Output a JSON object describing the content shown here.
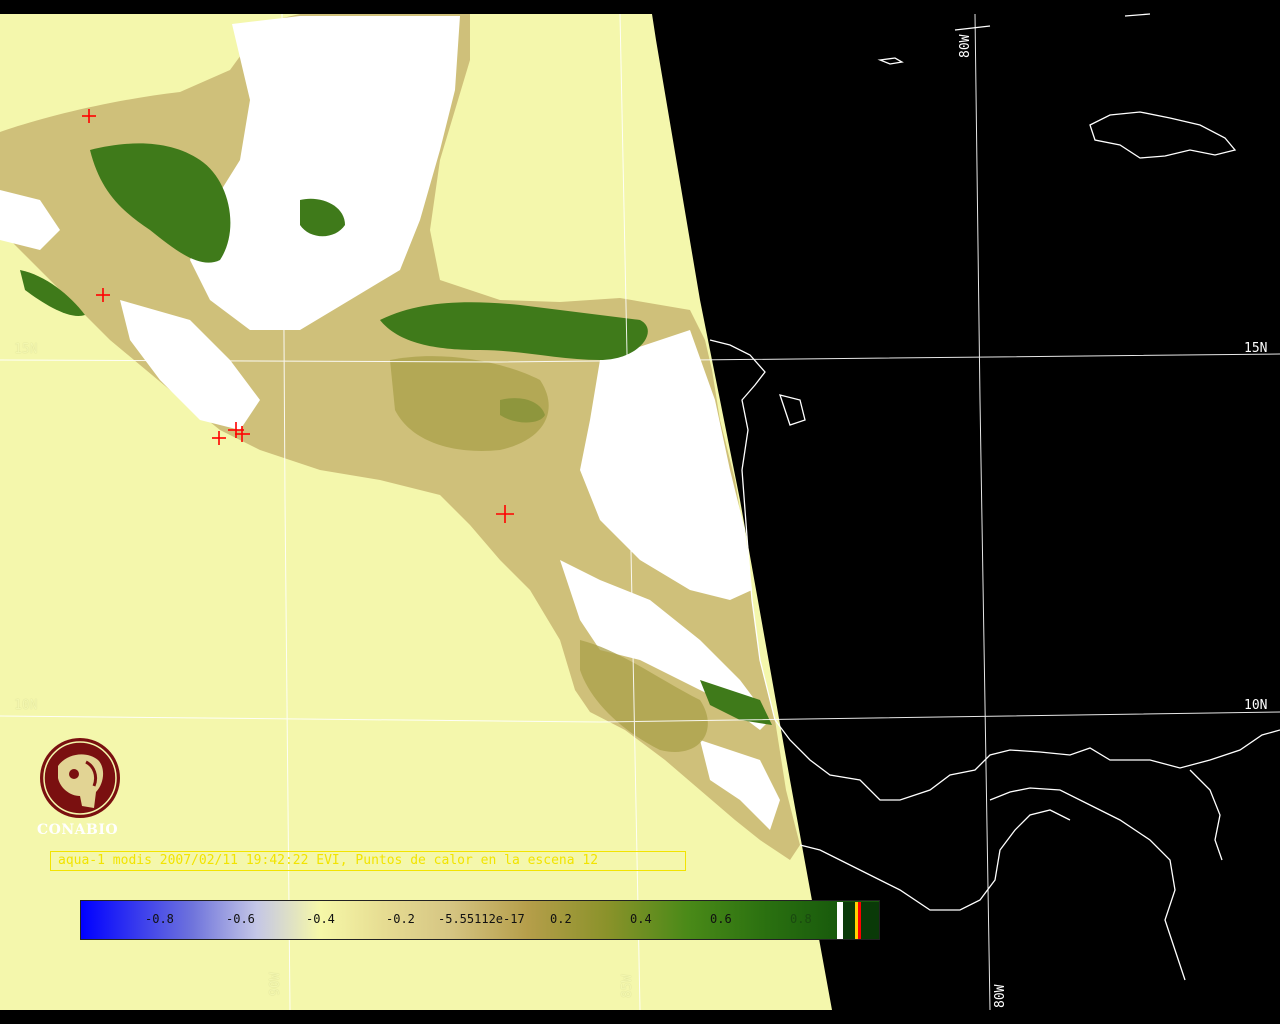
{
  "caption": "aqua-1 modis 2007/02/11 19:42:22 EVI, Puntos de calor en la escena 12",
  "logo": {
    "name": "CONABIO"
  },
  "grid_labels": {
    "lat_15_left": "15N",
    "lat_15_right": "15N",
    "lat_10_left": "10N",
    "lat_10_right": "10N",
    "lon_80_top": "80W",
    "lon_80_bottom": "80W",
    "lon_85_bottom": "85W",
    "lon_90_bottom": "90W"
  },
  "colorbar": {
    "ticks": [
      "-0.8",
      "-0.6",
      "-0.4",
      "-0.2",
      "-5.55112e-17",
      "0.2",
      "0.4",
      "0.6",
      "0.8"
    ],
    "gradient_colors": [
      "#0000ff",
      "#c4c6e6",
      "#f6f8a8",
      "#d6c684",
      "#8a922a",
      "#2a7010",
      "#185a0c"
    ],
    "extra_colors": [
      "#ffffff",
      "#0a3a08",
      "#ffd200",
      "#ff0000"
    ]
  },
  "hotspot_count": 12,
  "colors": {
    "ocean_in_swath": "#f4f7ac",
    "outside_swath": "#000000",
    "coast_and_grid": "#ffffff",
    "hotspot": "#ff0000",
    "caption": "#f2e400",
    "logo": "#7a1010"
  },
  "icons": [
    "hotspot-cross-icon",
    "conabio-logo-icon"
  ]
}
